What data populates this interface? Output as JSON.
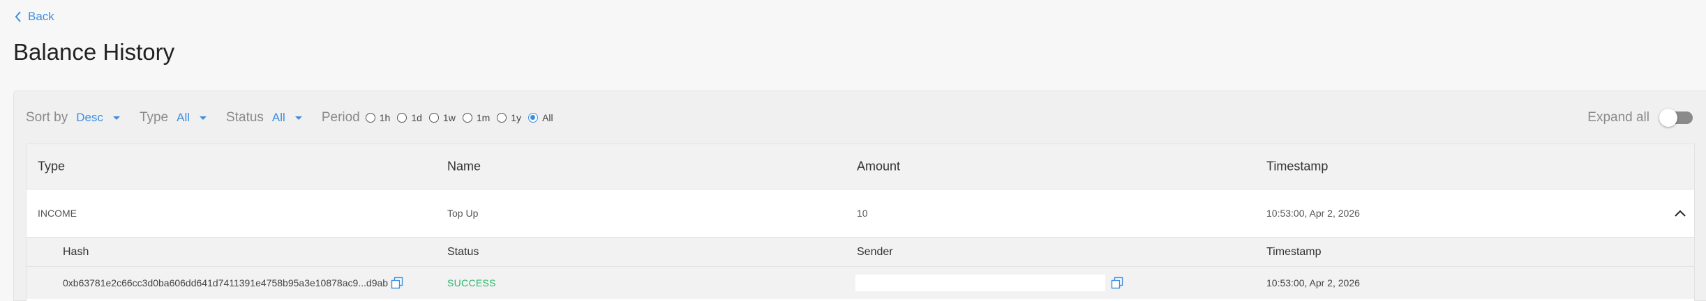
{
  "nav": {
    "back_label": "Back"
  },
  "page": {
    "title": "Balance History"
  },
  "filters": {
    "sort_label": "Sort by",
    "sort_value": "Desc",
    "type_label": "Type",
    "type_value": "All",
    "status_label": "Status",
    "status_value": "All",
    "period_label": "Period",
    "period_options": [
      "1h",
      "1d",
      "1w",
      "1m",
      "1y",
      "All"
    ],
    "period_selected": "All",
    "expand_all_label": "Expand all",
    "expand_all_on": false
  },
  "table": {
    "headers": [
      "Type",
      "Name",
      "Amount",
      "Timestamp"
    ],
    "rows": [
      {
        "type": "INCOME",
        "name": "Top Up",
        "amount": "10",
        "timestamp": "10:53:00, Apr 2, 2026"
      }
    ],
    "detail": {
      "headers": [
        "Hash",
        "Status",
        "Sender",
        "Timestamp"
      ],
      "hash": "0xb63781e2c66cc3d0ba606dd641d7411391e4758b95a3e10878ac9...d9ab",
      "status": "SUCCESS",
      "sender": "",
      "timestamp": "10:53:00, Apr 2, 2026"
    }
  },
  "colors": {
    "accent": "#3b8fe0",
    "success": "#2fb86e",
    "muted": "#8a8a8a"
  },
  "icons": {
    "back": "chevron-left-icon",
    "collapse": "chevron-up-icon",
    "copy": "copy-icon",
    "dropdown": "caret-down-icon"
  }
}
